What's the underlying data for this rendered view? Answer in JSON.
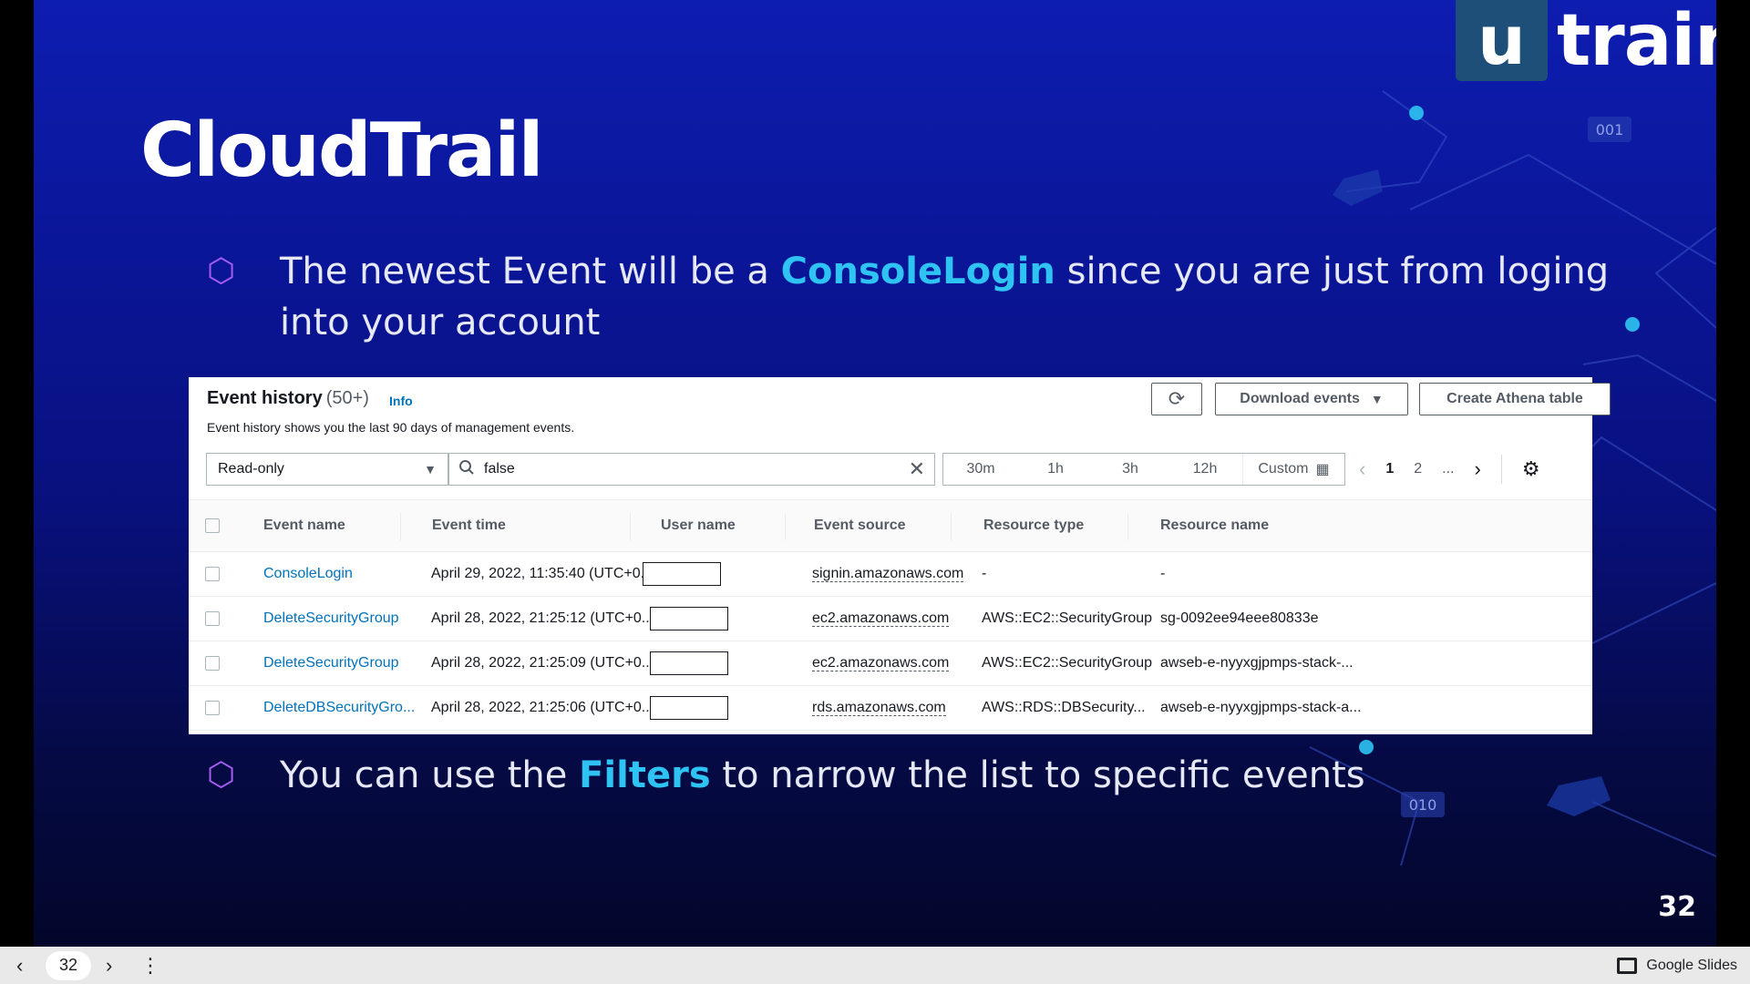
{
  "slide": {
    "logo_box": "u",
    "logo_text": "train",
    "title": "CloudTrail",
    "bullet1_a": "The newest Event will be a ",
    "bullet1_hl": "ConsoleLogin",
    "bullet1_b": " since you are just from loging into your account",
    "bullet2_a": "You can use the ",
    "bullet2_hl": "Filters",
    "bullet2_b": " to narrow the list to specific events",
    "bullet_marker": "⬡",
    "slide_number": "32",
    "deco_labels": [
      "001",
      "010"
    ],
    "colors": {
      "highlight": "#2ec3f3",
      "bullet": "#a45bf0"
    }
  },
  "panel": {
    "title": "Event history",
    "count": "(50+)",
    "info": "Info",
    "description": "Event history shows you the last 90 days of management events.",
    "refresh_icon": "⟳",
    "download_label": "Download events",
    "athena_label": "Create Athena table",
    "filter_value": "Read-only",
    "search_value": "false",
    "time_options": [
      "30m",
      "1h",
      "3h",
      "12h"
    ],
    "custom_label": "Custom",
    "pager": {
      "current": "1",
      "next_page": "2",
      "ellipsis": "..."
    },
    "columns": [
      "Event name",
      "Event time",
      "User name",
      "Event source",
      "Resource type",
      "Resource name"
    ],
    "rows": [
      {
        "name": "ConsoleLogin",
        "time": "April 29, 2022, 11:35:40 (UTC+0...",
        "source": "signin.amazonaws.com",
        "rtype": "-",
        "rname": "-"
      },
      {
        "name": "DeleteSecurityGroup",
        "time": "April 28, 2022, 21:25:12 (UTC+0...",
        "source": "ec2.amazonaws.com",
        "rtype": "AWS::EC2::SecurityGroup",
        "rname": "sg-0092ee94eee80833e"
      },
      {
        "name": "DeleteSecurityGroup",
        "time": "April 28, 2022, 21:25:09 (UTC+0...",
        "source": "ec2.amazonaws.com",
        "rtype": "AWS::EC2::SecurityGroup",
        "rname": "awseb-e-nyyxgjpmps-stack-..."
      },
      {
        "name": "DeleteDBSecurityGro...",
        "time": "April 28, 2022, 21:25:06 (UTC+0...",
        "source": "rds.amazonaws.com",
        "rtype": "AWS::RDS::DBSecurity...",
        "rname": "awseb-e-nyyxgjpmps-stack-a..."
      }
    ]
  },
  "bottom_bar": {
    "page": "32",
    "app_name": "Google Slides"
  }
}
